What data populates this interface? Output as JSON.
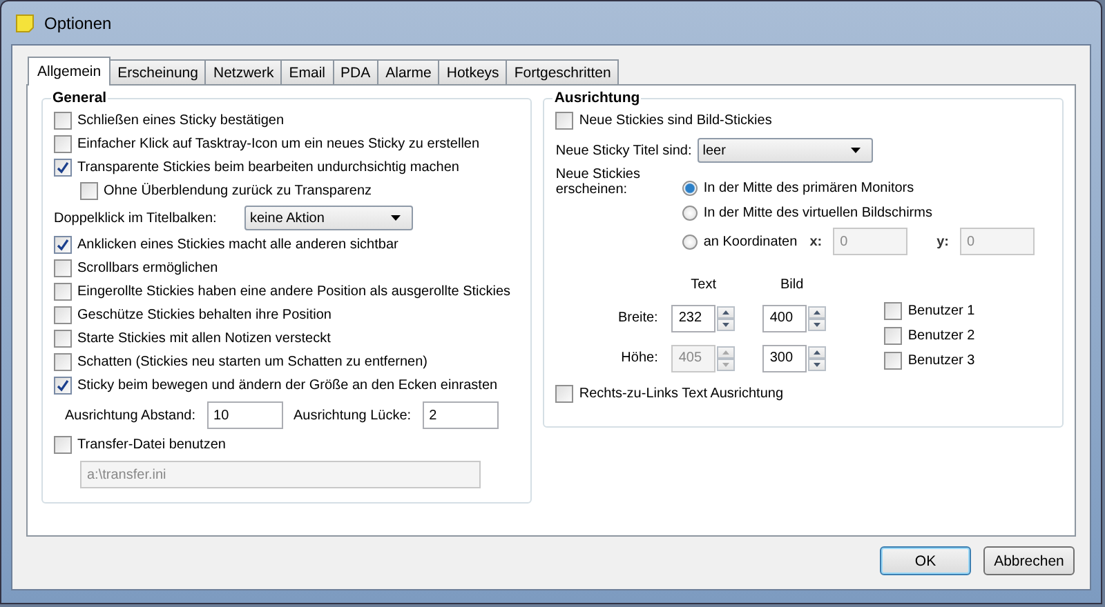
{
  "window": {
    "title": "Optionen"
  },
  "tabs": [
    {
      "label": "Allgemein",
      "selected": true
    },
    {
      "label": "Erscheinung",
      "selected": false
    },
    {
      "label": "Netzwerk",
      "selected": false
    },
    {
      "label": "Email",
      "selected": false
    },
    {
      "label": "PDA",
      "selected": false
    },
    {
      "label": "Alarme",
      "selected": false
    },
    {
      "label": "Hotkeys",
      "selected": false
    },
    {
      "label": "Fortgeschritten",
      "selected": false
    }
  ],
  "general": {
    "title": "General",
    "items": [
      {
        "kind": "checkbox",
        "label": "Schließen eines Sticky bestätigen",
        "checked": false
      },
      {
        "kind": "checkbox",
        "label": "Einfacher Klick auf Tasktray-Icon um ein neues Sticky zu erstellen",
        "checked": false
      },
      {
        "kind": "checkbox",
        "label": "Transparente Stickies beim bearbeiten undurchsichtig machen",
        "checked": true,
        "children": [
          {
            "kind": "checkbox",
            "label": "Ohne Überblendung zurück zu Transparenz",
            "checked": false
          }
        ]
      },
      {
        "kind": "select",
        "label": "Doppelklick im Titelbalken:",
        "value": "keine Aktion"
      },
      {
        "kind": "checkbox",
        "label": "Anklicken eines Stickies macht alle anderen sichtbar",
        "checked": true
      },
      {
        "kind": "checkbox",
        "label": "Scrollbars ermöglichen",
        "checked": false
      },
      {
        "kind": "checkbox",
        "label": "Eingerollte Stickies haben eine andere Position als ausgerollte Stickies",
        "checked": false
      },
      {
        "kind": "checkbox",
        "label": "Geschütze Stickies behalten ihre Position",
        "checked": false
      },
      {
        "kind": "checkbox",
        "label": "Starte Stickies mit allen Notizen versteckt",
        "checked": false
      },
      {
        "kind": "checkbox",
        "label": "Schatten (Stickies neu starten um Schatten zu entfernen)",
        "checked": false
      },
      {
        "kind": "checkbox",
        "label": "Sticky beim bewegen und ändern der Größe an den Ecken einrasten",
        "checked": true
      },
      {
        "kind": "pair",
        "fields": [
          {
            "label": "Ausrichtung Abstand:",
            "value": "10"
          },
          {
            "label": "Ausrichtung Lücke:",
            "value": "2"
          }
        ]
      },
      {
        "kind": "checkbox",
        "label": "Transfer-Datei benutzen",
        "checked": false
      },
      {
        "kind": "field",
        "value": "a:\\transfer.ini",
        "disabled": true
      }
    ]
  },
  "alignment": {
    "title": "Ausrichtung",
    "image_stickies": {
      "label": "Neue Stickies sind Bild-Stickies",
      "checked": false
    },
    "title_select": {
      "label": "Neue Sticky Titel sind:",
      "value": "leer"
    },
    "appear": {
      "label": "Neue Stickies erscheinen:",
      "options": [
        {
          "label": "In der Mitte des primären Monitors",
          "selected": true
        },
        {
          "label": "In der Mitte des virtuellen Bildschirms",
          "selected": false
        },
        {
          "label": "an Koordinaten",
          "selected": false
        }
      ],
      "coords": [
        {
          "label": "x:",
          "value": "0",
          "disabled": true
        },
        {
          "label": "y:",
          "value": "0",
          "disabled": true
        }
      ]
    },
    "size": {
      "columns": [
        "Text",
        "Bild"
      ],
      "rows": [
        {
          "label": "Breite:",
          "cells": [
            {
              "value": "232",
              "disabled": false
            },
            {
              "value": "400",
              "disabled": false
            }
          ]
        },
        {
          "label": "Höhe:",
          "cells": [
            {
              "value": "405",
              "disabled": true
            },
            {
              "value": "300",
              "disabled": false
            }
          ]
        }
      ]
    },
    "users": [
      {
        "label": "Benutzer 1",
        "checked": false
      },
      {
        "label": "Benutzer 2",
        "checked": false
      },
      {
        "label": "Benutzer 3",
        "checked": false
      }
    ],
    "rtl": {
      "label": "Rechts-zu-Links Text Ausrichtung",
      "checked": false
    }
  },
  "buttons": [
    {
      "label": "OK",
      "default": true
    },
    {
      "label": "Abbrechen",
      "default": false
    }
  ]
}
